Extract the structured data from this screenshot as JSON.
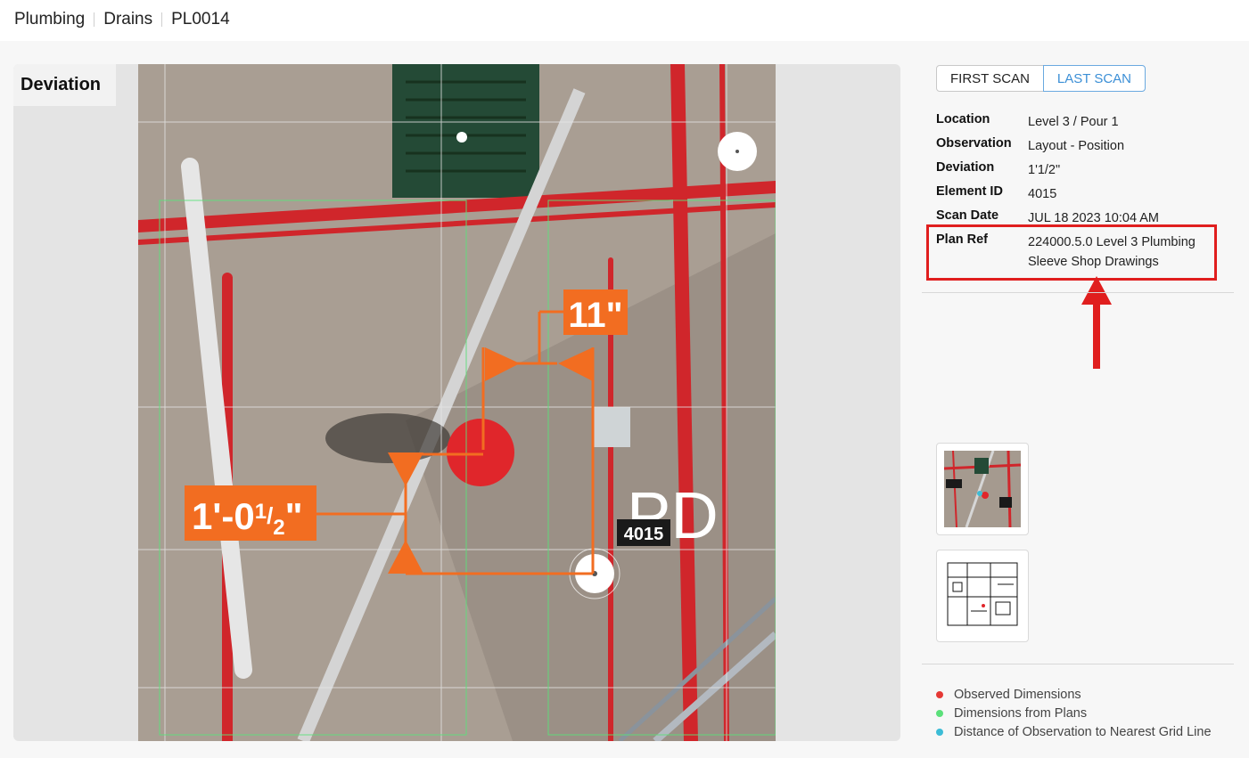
{
  "breadcrumb": [
    "Plumbing",
    "Drains",
    "PL0014"
  ],
  "viewer": {
    "title": "Deviation",
    "dim_horizontal": "11\"",
    "dim_vertical_main": "1'-0",
    "dim_vertical_num": "1",
    "dim_vertical_den": "2",
    "dim_vertical_suffix": "\"",
    "element_tag": "4015",
    "plan_symbol": "PD"
  },
  "scan_toggle": {
    "first": "FIRST SCAN",
    "last": "LAST SCAN",
    "active": "last"
  },
  "details": [
    {
      "label": "Location",
      "value": "Level 3 / Pour 1"
    },
    {
      "label": "Observation",
      "value": "Layout - Position"
    },
    {
      "label": "Deviation",
      "value": "1'1/2\""
    },
    {
      "label": "Element ID",
      "value": "4015"
    },
    {
      "label": "Scan Date",
      "value": "JUL 18 2023 10:04 AM"
    },
    {
      "label": "Plan Ref",
      "value": "224000.5.0 Level 3 Plumbing Sleeve Shop Drawings"
    }
  ],
  "legend": [
    {
      "label": "Observed Dimensions",
      "color": "#e53935"
    },
    {
      "label": "Dimensions from Plans",
      "color": "#5be07a"
    },
    {
      "label": "Distance of Observation to Nearest Grid Line",
      "color": "#3cbcd6"
    }
  ],
  "colors": {
    "accent": "#3b8fd6",
    "dimension": "#f26d21",
    "annotation": "#e01e1e"
  }
}
